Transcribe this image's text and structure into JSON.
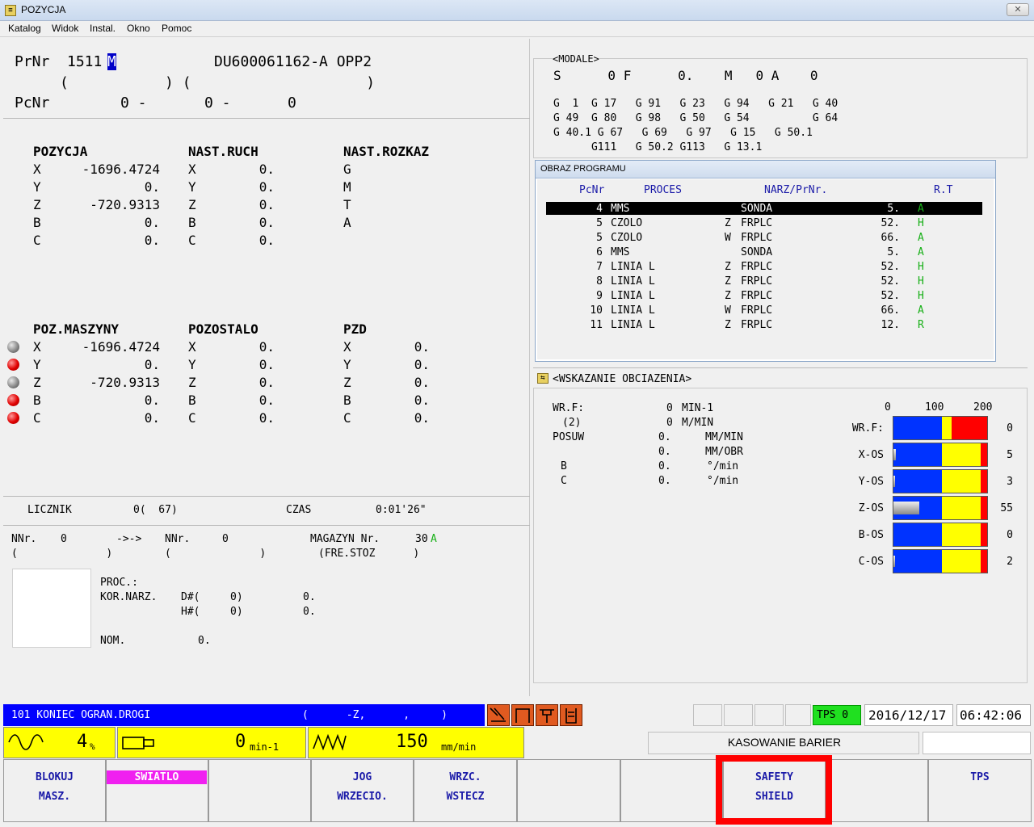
{
  "window": {
    "title": "POZYCJA",
    "close": "✕"
  },
  "menu": [
    "Katalog",
    "Widok",
    "Instal.",
    "Okno",
    "Pomoc"
  ],
  "header": {
    "prnr_label": "PrNr",
    "prnr_value": "1511",
    "prnr_suffix": "M",
    "program_name": "DU600061162-A OPP2",
    "paren_line": "(           ) (                    )",
    "pcnr_label": "PcNr",
    "pcnr_a": "0 -",
    "pcnr_b": "0 -",
    "pcnr_c": "0"
  },
  "pozycja": {
    "headers": [
      "POZYCJA",
      "NAST.RUCH",
      "NAST.ROZKAZ"
    ],
    "axes": [
      "X",
      "Y",
      "Z",
      "B",
      "C"
    ],
    "values": [
      "-1696.4724",
      "0.",
      "-720.9313",
      "0.",
      "0."
    ],
    "nast_ruch": [
      "0.",
      "0.",
      "0.",
      "0.",
      "0."
    ],
    "nast_rozkaz": [
      "G",
      "M",
      "T",
      "A"
    ]
  },
  "maszyny": {
    "headers": [
      "POZ.MASZYNY",
      "POZOSTALO",
      "PZD"
    ],
    "values": [
      "-1696.4724",
      "0.",
      "-720.9313",
      "0.",
      "0."
    ],
    "pozostalo": [
      "0.",
      "0.",
      "0.",
      "0.",
      "0."
    ],
    "pzd": [
      "0.",
      "0.",
      "0.",
      "0.",
      "0."
    ],
    "ball_colors": [
      "gray",
      "red",
      "gray",
      "red",
      "red"
    ]
  },
  "licznik": {
    "label": "LICZNIK",
    "value": "0(  67)",
    "czas_label": "CZAS",
    "czas_value": "0:01'26\""
  },
  "nnr": {
    "left_label": "NNr.",
    "left_value": "0",
    "arrow": "->->",
    "right_label": "NNr.",
    "right_value": "0",
    "magazyn_label": "MAGAZYN Nr.",
    "magazyn_value": "30",
    "magazyn_suffix": "A",
    "paren_left": "(              )",
    "paren_mid": "(              )",
    "fre_stoz": "(FRE.STOZ      )"
  },
  "proc": {
    "proc_label": "PROC.:",
    "kor_label": "KOR.NARZ.",
    "d_label": "D#(",
    "d_value": "0)",
    "d_amount": "0.",
    "h_label": "H#(",
    "h_value": "0)",
    "h_amount": "0.",
    "nom_label": "NOM.",
    "nom_value": "0."
  },
  "modale": {
    "title": "<MODALE>",
    "top_line": "S      0 F      0.    M   0 A    0",
    "g_rows": [
      "G  1  G 17   G 91   G 23   G 94   G 21   G 40",
      "G 49  G 80   G 98   G 50   G 54          G 64",
      "G 40.1 G 67   G 69   G 97   G 15   G 50.1",
      "      G111   G 50.2 G113   G 13.1"
    ]
  },
  "obraz": {
    "title": "OBRAZ PROGRAMU",
    "columns": [
      "PcNr",
      "PROCES",
      "NARZ/PrNr.",
      "R.T"
    ],
    "rows": [
      {
        "pc": "4",
        "proc": "MMS",
        "side": "",
        "narz": "SONDA",
        "val": "5.",
        "rt": "A"
      },
      {
        "pc": "5",
        "proc": "CZOLO",
        "side": "Z",
        "narz": "FRPLC",
        "val": "52.",
        "rt": "H"
      },
      {
        "pc": "5",
        "proc": "CZOLO",
        "side": "W",
        "narz": "FRPLC",
        "val": "66.",
        "rt": "A"
      },
      {
        "pc": "6",
        "proc": "MMS",
        "side": "",
        "narz": "SONDA",
        "val": "5.",
        "rt": "A"
      },
      {
        "pc": "7",
        "proc": "LINIA L",
        "side": "Z",
        "narz": "FRPLC",
        "val": "52.",
        "rt": "H"
      },
      {
        "pc": "8",
        "proc": "LINIA L",
        "side": "Z",
        "narz": "FRPLC",
        "val": "52.",
        "rt": "H"
      },
      {
        "pc": "9",
        "proc": "LINIA L",
        "side": "Z",
        "narz": "FRPLC",
        "val": "52.",
        "rt": "H"
      },
      {
        "pc": "10",
        "proc": "LINIA L",
        "side": "W",
        "narz": "FRPLC",
        "val": "66.",
        "rt": "A"
      },
      {
        "pc": "11",
        "proc": "LINIA L",
        "side": "Z",
        "narz": "FRPLC",
        "val": "12.",
        "rt": "R"
      }
    ]
  },
  "obciazenie": {
    "title": "<WSKAZANIE OBCIAZENIA>",
    "wrf_label": "WR.F:",
    "wrf_value": "0",
    "wrf_unit": "MIN-1",
    "two_label": "(2)",
    "two_value": "0",
    "two_unit": "M/MIN",
    "posuw_label": "POSUW",
    "posuw_value": "0.",
    "posuw_unit": "MM/MIN",
    "obr_value": "0.",
    "obr_unit": "MM/OBR",
    "b_label": "B",
    "b_value": "0.",
    "b_unit": "°/min",
    "c_label": "C",
    "c_value": "0.",
    "c_unit": "°/min",
    "scale": [
      "0",
      "100",
      "200"
    ],
    "bars": [
      {
        "label": "WR.F:",
        "value": "0",
        "load": 0
      },
      {
        "label": "X-OS",
        "value": "5",
        "load": 5
      },
      {
        "label": "Y-OS",
        "value": "3",
        "load": 3
      },
      {
        "label": "Z-OS",
        "value": "55",
        "load": 55
      },
      {
        "label": "B-OS",
        "value": "0",
        "load": 0
      },
      {
        "label": "C-OS",
        "value": "2",
        "load": 2
      }
    ]
  },
  "status": {
    "alarm": "101 KONIEC OGRAN.DROGI",
    "alarm_axis": "(      -Z,      ,     )",
    "tps": "TPS 0",
    "date": "2016/12/17",
    "time": "06:42:06"
  },
  "overrides": {
    "rapid_value": "4",
    "rapid_unit": "%",
    "spindle_value": "0",
    "spindle_unit": "min-1",
    "feed_value": "150",
    "feed_unit": "mm/min"
  },
  "kasowanie": "KASOWANIE BARIER",
  "softkeys": [
    {
      "l1": "BLOKUJ",
      "l2": "MASZ."
    },
    {
      "l1": "SWIATLO",
      "l2": ""
    },
    {
      "l1": "",
      "l2": ""
    },
    {
      "l1": "JOG",
      "l2": "WRZECIO."
    },
    {
      "l1": "WRZC.",
      "l2": "WSTECZ"
    },
    {
      "l1": "",
      "l2": ""
    },
    {
      "l1": "",
      "l2": ""
    },
    {
      "l1": "SAFETY",
      "l2": "SHIELD"
    },
    {
      "l1": "",
      "l2": ""
    },
    {
      "l1": "TPS",
      "l2": ""
    }
  ],
  "colors": {
    "load_blue": "#0033ff",
    "load_yellow": "#ffff00",
    "load_red": "#ff0000",
    "highlight": "#ff0000",
    "alarm_bg": "#0000ff"
  }
}
